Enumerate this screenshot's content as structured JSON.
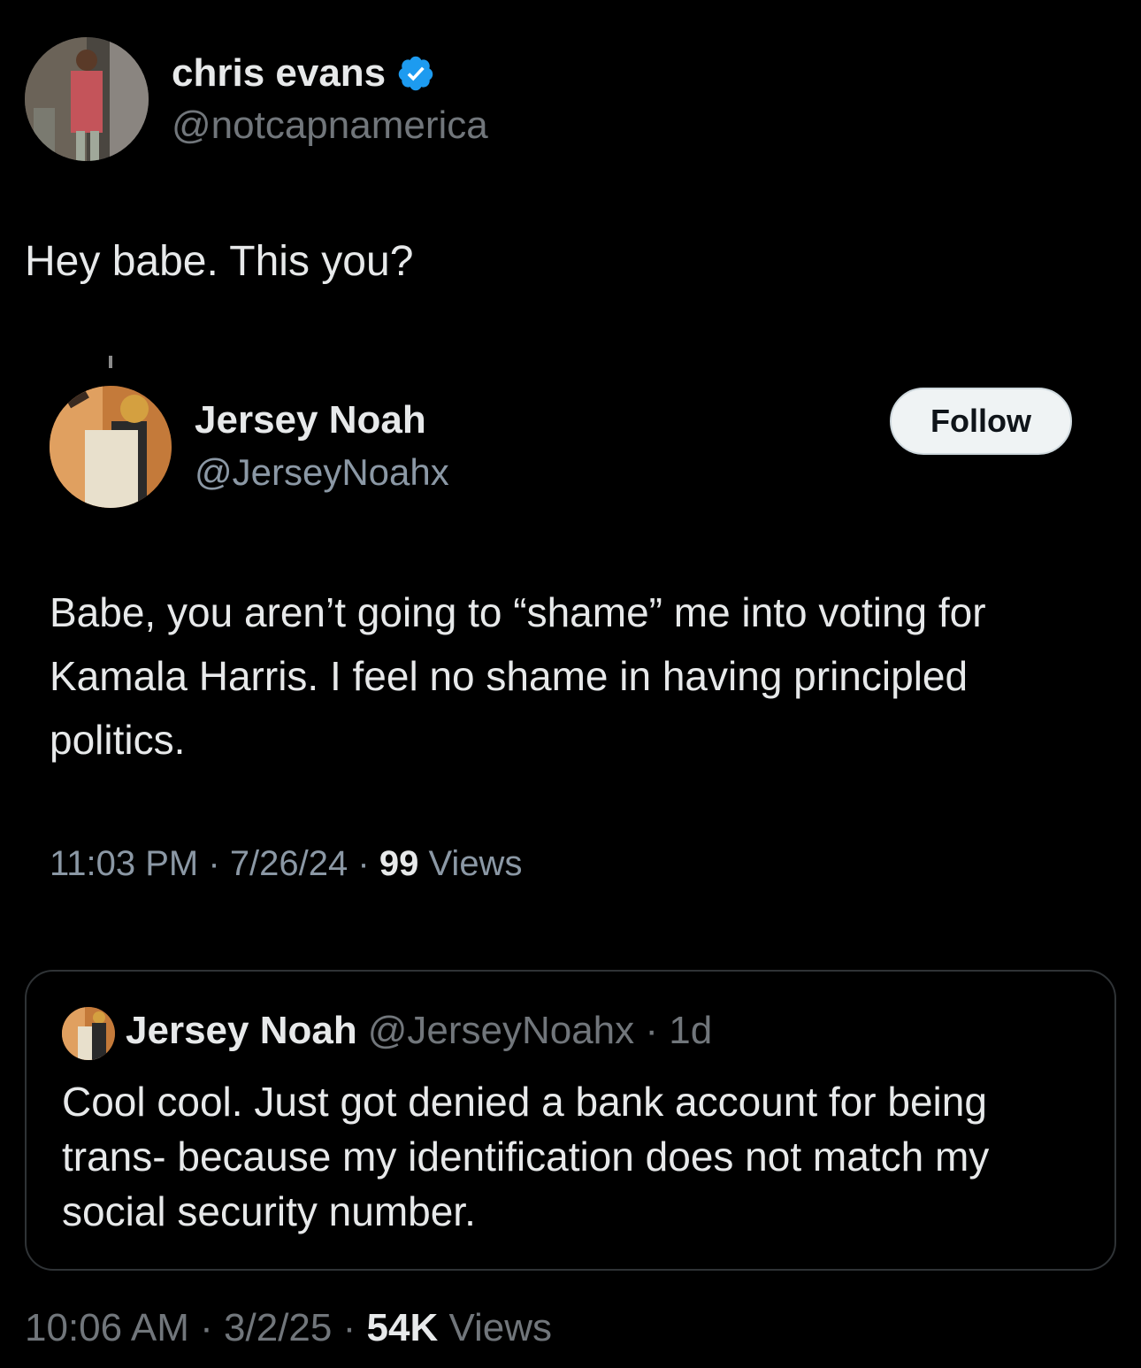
{
  "author": {
    "name": "chris evans",
    "handle": "@notcapnamerica",
    "verified_color": "#1d9bf0"
  },
  "tweet": {
    "text": "Hey babe. This you?"
  },
  "screenshot": {
    "name": "Jersey Noah",
    "handle": "@JerseyNoahx",
    "follow_label": "Follow",
    "body": "Babe, you aren’t going to “shame” me into voting for Kamala Harris. I feel no shame in having principled politics.",
    "time": "11:03 PM",
    "date": "7/26/24",
    "views_count": "99",
    "views_label": "Views"
  },
  "quote": {
    "name": "Jersey Noah",
    "handle": "@JerseyNoahx",
    "age": "1d",
    "body": "Cool cool. Just got denied a bank account for being trans- because my identification does not match my social security number."
  },
  "footer": {
    "time": "10:06 AM",
    "date": "3/2/25",
    "views_count": "54K",
    "views_label": "Views"
  }
}
